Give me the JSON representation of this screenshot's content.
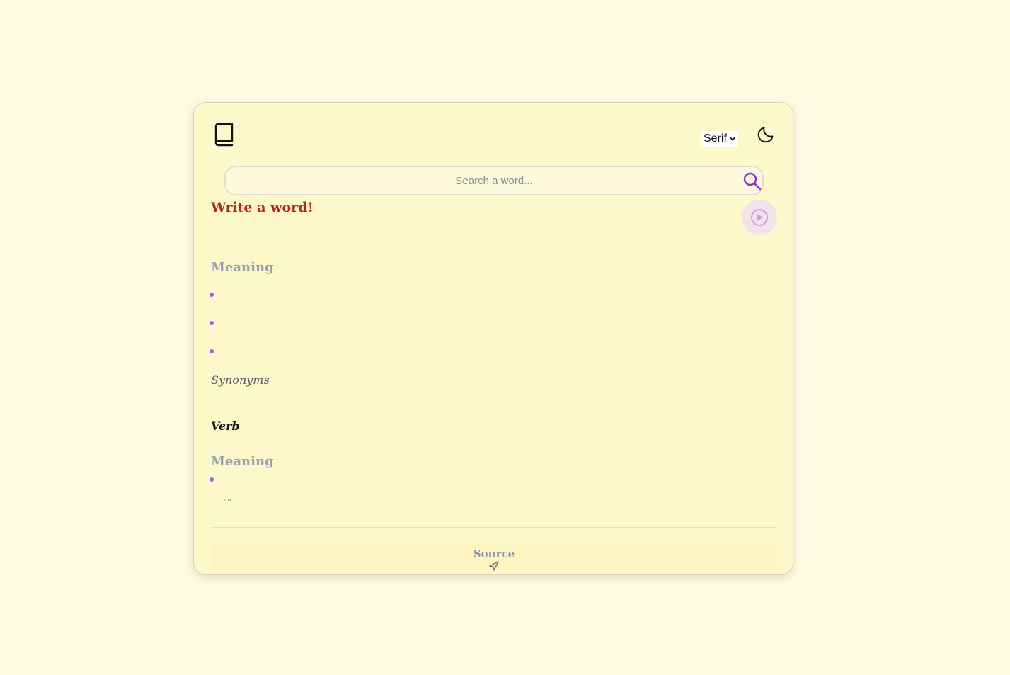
{
  "header": {
    "logo_icon": "book-icon",
    "font_select": {
      "selected": "Serif"
    },
    "theme_toggle_icon": "moon-icon"
  },
  "search": {
    "placeholder": "Search a word...",
    "value": "",
    "icon": "search-icon"
  },
  "result": {
    "word": "Write a word!",
    "play_icon": "play-circle-icon",
    "sections": [
      {
        "meaning_heading": "Meaning",
        "definitions": [
          "",
          "",
          ""
        ],
        "synonyms_label": "Synonyms"
      },
      {
        "part_of_speech": "Verb",
        "meaning_heading": "Meaning",
        "definitions": [
          ""
        ],
        "example": "\"\""
      }
    ]
  },
  "footer": {
    "source_label": "Source",
    "link_icon": "send-icon"
  },
  "colors": {
    "page_bg": "#fefbe3",
    "card_bg": "#fdf8c9",
    "accent": "#a855f7",
    "word": "#b4261a",
    "muted_heading": "#9aa0b1"
  }
}
